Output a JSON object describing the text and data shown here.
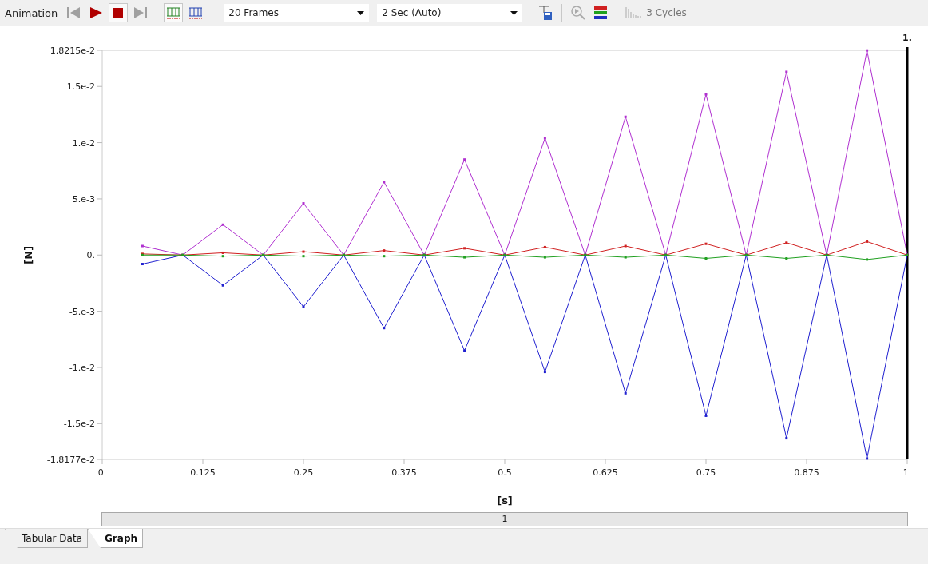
{
  "toolbar": {
    "label": "Animation",
    "buttons": [
      {
        "kind": "first",
        "disabled": true
      },
      {
        "kind": "play"
      },
      {
        "kind": "stop"
      },
      {
        "kind": "last",
        "disabled": true
      },
      {
        "kind": "frames-red"
      },
      {
        "kind": "frames-blue"
      }
    ],
    "frames": "20 Frames",
    "duration": "2 Sec (Auto)",
    "tools": [
      {
        "kind": "export"
      },
      {
        "kind": "zoom-play",
        "disabled": true
      },
      {
        "kind": "color-bars"
      },
      {
        "kind": "cycles",
        "disabled": true
      }
    ],
    "cycles": {
      "text": "3 Cycles",
      "disabled": true
    }
  },
  "graph": {
    "cursor_label": "1.",
    "chart_data": {
      "type": "line",
      "xlabel": "[s]",
      "ylabel": "[N]",
      "x": [
        0.05,
        0.1,
        0.15,
        0.2,
        0.25,
        0.3,
        0.35,
        0.4,
        0.45,
        0.5,
        0.55,
        0.6,
        0.65,
        0.7,
        0.75,
        0.8,
        0.85,
        0.9,
        0.95,
        1.0
      ],
      "series": [
        {
          "color": "#b030d0",
          "marker": "square",
          "values": [
            0.0008,
            0,
            0.0027,
            0,
            0.0046,
            0,
            0.0065,
            0,
            0.0085,
            0,
            0.0104,
            0,
            0.0123,
            0,
            0.0143,
            0,
            0.0163,
            0,
            0.0182,
            0
          ]
        },
        {
          "color": "#2020d0",
          "marker": "square",
          "values": [
            -0.0008,
            0,
            -0.0027,
            0,
            -0.0046,
            0,
            -0.0065,
            0,
            -0.0085,
            0,
            -0.0104,
            0,
            -0.0123,
            0,
            -0.0143,
            0,
            -0.0163,
            0,
            -0.0181,
            0
          ]
        },
        {
          "color": "#d02020",
          "marker": "square",
          "values": [
            0.0001,
            0,
            0.0002,
            0,
            0.0003,
            0,
            0.0004,
            0,
            0.0006,
            0,
            0.0007,
            0,
            0.0008,
            0,
            0.001,
            0,
            0.0011,
            0,
            0.0012,
            0
          ]
        },
        {
          "color": "#20a020",
          "marker": "square",
          "values": [
            0,
            0,
            -0.0001,
            0,
            -0.0001,
            0,
            -0.0001,
            0,
            -0.0002,
            0,
            -0.0002,
            0,
            -0.0002,
            0,
            -0.0003,
            0,
            -0.0003,
            0,
            -0.0004,
            0
          ]
        }
      ],
      "xlim": [
        0,
        1
      ],
      "ylim": [
        -0.018177,
        0.018215
      ],
      "xticks": [
        {
          "value": 0,
          "label": "0."
        },
        0.125,
        0.25,
        0.375,
        0.5,
        0.625,
        0.75,
        0.875,
        {
          "value": 1,
          "label": "1."
        }
      ],
      "yticks": [
        {
          "value": 0.018215,
          "label": "1.8215e-2"
        },
        {
          "value": 0.015,
          "label": "1.5e-2"
        },
        {
          "value": 0.01,
          "label": "1.e-2"
        },
        {
          "value": 0.005,
          "label": "5.e-3"
        },
        {
          "value": 0,
          "label": "0."
        },
        {
          "value": -0.005,
          "label": "-5.e-3"
        },
        {
          "value": -0.01,
          "label": "-1.e-2"
        },
        {
          "value": -0.015,
          "label": "-1.5e-2"
        },
        {
          "value": -0.018177,
          "label": "-1.8177e-2"
        }
      ]
    },
    "step_bar": "1"
  },
  "tabs": [
    {
      "label": "Tabular Data",
      "selected": false
    },
    {
      "label": "Graph",
      "selected": true
    }
  ]
}
